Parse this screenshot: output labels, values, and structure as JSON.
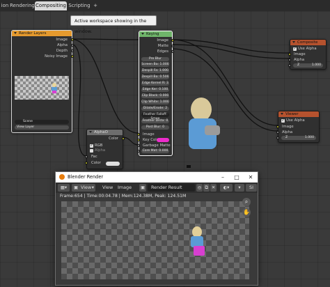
{
  "tabs": [
    {
      "label": "ion"
    },
    {
      "label": "Rendering"
    },
    {
      "label": "Compositing"
    },
    {
      "label": "Scripting"
    },
    {
      "label": "+"
    }
  ],
  "tooltip": "Active workspace showing in the window.",
  "render_layers": {
    "title": "Render Layers",
    "outputs": [
      "Image",
      "Alpha",
      "Depth",
      "Noisy Image"
    ],
    "scene": "Scene",
    "view_layer": "View Layer"
  },
  "mix": {
    "title": "AlphaO",
    "output": "Color",
    "opt_rgb": "RGB",
    "opt_alpha": "Alpha",
    "in_fac": "Fac",
    "in_color": "Color"
  },
  "keying": {
    "title": "Keying",
    "outputs": [
      "Image",
      "Matte",
      "Edges"
    ],
    "fields": [
      "Pre Blur",
      "Screen Ba: 1.000",
      "Despill Fa: 1.000",
      "Despill Ba: 0.500",
      "Edge Kernel R: 3",
      "Edge Ker: 0.100",
      "Clip Black: 0.000",
      "Clip White: 1.000",
      "Dilate/Erode: 2",
      "Feather Falloff: Smoo",
      "Feather Dista: 0",
      "Post Blur: 0"
    ],
    "inputs": {
      "image": "Image",
      "key_color": "Key Colo",
      "garbage": "Garbage Matte",
      "core": "Core Mat: 0.000"
    },
    "key_color_hex": "#ee2ccc"
  },
  "composite": {
    "title": "Composite",
    "use_alpha": "Use Alpha",
    "in_image": "Image",
    "in_alpha": "Alpha",
    "z_label": "Z",
    "z_value": "1.000"
  },
  "viewer": {
    "title": "Viewer",
    "use_alpha": "Use Alpha",
    "in_image": "Image",
    "in_alpha": "Alpha",
    "z_label": "Z",
    "z_value": "1.000"
  },
  "render_window": {
    "title": "Blender Render",
    "menu_view": "View",
    "menu_view2": "View",
    "menu_image": "Image",
    "image_name": "Render Result",
    "info": "Frame:654 | Time:00:04.78 | Mem:124.38M, Peak: 124.51M",
    "slot": "SI"
  },
  "colors": {
    "node_header_input": "#e59a2e",
    "node_header_matte": "#6fb56a",
    "node_header_output": "#6d6d6d",
    "socket_color": "#c7c729",
    "socket_value": "#9a9a9a",
    "subject_shirt": "#5b9bd5",
    "subject_dress": "#d83fd0"
  }
}
